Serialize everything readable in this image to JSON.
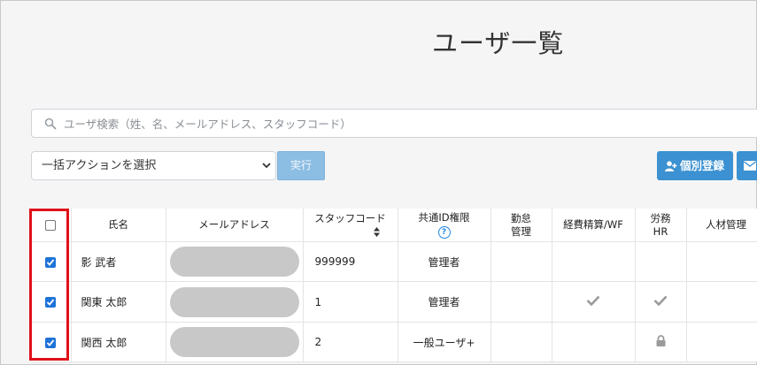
{
  "page": {
    "title": "ユーザ一覧"
  },
  "search": {
    "placeholder": "ユーザ検索（姓、名、メールアドレス、スタッフコード）"
  },
  "bulk_action": {
    "selected": "一括アクションを選択",
    "execute_label": "実行"
  },
  "toolbar": {
    "add_label": "個別登録"
  },
  "table": {
    "headers": {
      "name": "氏名",
      "email": "メールアドレス",
      "staff_code": "スタッフコード",
      "shared_id_permission": "共通ID権限",
      "attendance": "勤怠管理",
      "expense": "経費精算/WF",
      "labor_hr": "労務HR",
      "talent": "人材管理"
    },
    "rows": [
      {
        "checked": true,
        "name": "影 武者",
        "staff_code": "999999",
        "permission": "管理者",
        "expense_check": false,
        "labor_check": false,
        "labor_lock": false
      },
      {
        "checked": true,
        "name": "関東 太郎",
        "staff_code": "1",
        "permission": "管理者",
        "expense_check": true,
        "labor_check": true,
        "labor_lock": false
      },
      {
        "checked": true,
        "name": "関西 太郎",
        "staff_code": "2",
        "permission": "一般ユーザ+",
        "expense_check": false,
        "labor_check": false,
        "labor_lock": true
      }
    ]
  },
  "colors": {
    "accent": "#3b91d1",
    "checkbox": "#1e73d8",
    "highlight": "#e0111b"
  }
}
